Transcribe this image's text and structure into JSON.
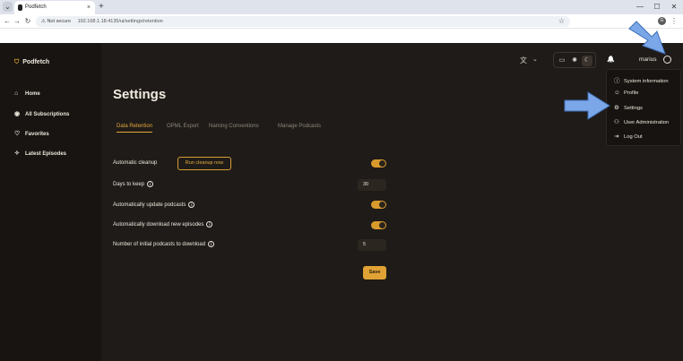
{
  "browser": {
    "tab_title": "Podfetch",
    "tab_close": "×",
    "new_tab": "+",
    "window_controls": {
      "minimize": "—",
      "maximize": "☐",
      "close": "✕"
    },
    "address": {
      "security": "⚠ Not secure",
      "url": "192.168.1.18:4135/ui/settings/retention"
    },
    "nav": {
      "back": "←",
      "forward": "→",
      "reload": "↻",
      "star": "☆",
      "menu": "⋮"
    },
    "profile_initial": "G"
  },
  "app": {
    "logo": "Podfetch",
    "logo_icon": "podfetch-logo-icon",
    "sidebar": [
      {
        "label": "Home",
        "icon": "⌂"
      },
      {
        "label": "All Subscriptions",
        "icon": "◉"
      },
      {
        "label": "Favorites",
        "icon": "♡"
      },
      {
        "label": "Latest Episodes",
        "icon": "✧"
      }
    ],
    "header": {
      "translate_icon": "文",
      "translate_caret": "⌄",
      "theme_options": [
        "▭",
        "✺",
        "☾"
      ],
      "bell": "🔔",
      "user": "marius"
    },
    "page_title": "Settings",
    "tabs": [
      "Data Retention",
      "OPML Export",
      "Naming Conventions",
      "Manage Podcasts"
    ],
    "settings": {
      "automatic_cleanup": "Automatic cleanup",
      "run_cleanup_label": "Run cleanup now",
      "days_to_keep": "Days to keep",
      "days_to_keep_value": "30",
      "auto_update": "Automatically update podcasts",
      "auto_download": "Automatically download new episodes",
      "initial_podcasts": "Number of initial podcasts to download",
      "initial_podcasts_value": "5",
      "save_label": "Save",
      "info_glyph": "i"
    },
    "dropdown": [
      {
        "label": "System information",
        "icon": "ⓘ"
      },
      {
        "label": "Profile",
        "icon": "☺"
      },
      {
        "label": "Settings",
        "icon": "⚙"
      },
      {
        "label": "User Administration",
        "icon": "⚇"
      },
      {
        "label": "Log Out",
        "icon": "⇥"
      }
    ]
  },
  "colors": {
    "accent": "#e0a234",
    "annotation_arrow": "#7ba7e8"
  }
}
